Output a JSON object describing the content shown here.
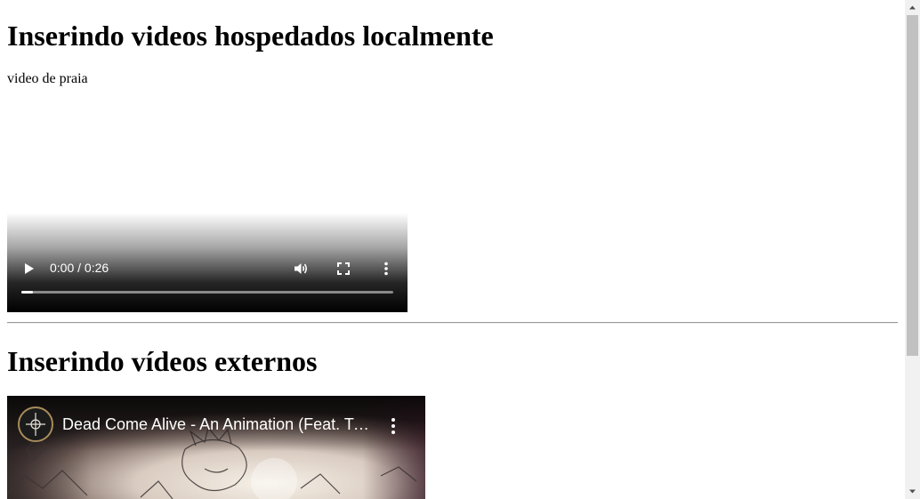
{
  "sections": {
    "local": {
      "heading": "Inserindo videos hospedados localmente",
      "caption": "video de praia",
      "player": {
        "time": "0:00 / 0:26",
        "progress_fraction": 0.03,
        "icons": [
          "play-icon",
          "volume-icon",
          "fullscreen-icon",
          "more-options-icon"
        ]
      }
    },
    "external": {
      "heading": "Inserindo vídeos externos",
      "embed": {
        "title": "Dead Come Alive - An Animation (Feat. Tyl…",
        "icons": [
          "channel-avatar-icon",
          "more-options-icon"
        ]
      }
    }
  },
  "colors": {
    "background": "#ffffff",
    "controls_gradient_end": "#000000",
    "divider": "#9a9a9a",
    "scrollbar_track": "#f1f1f1",
    "scrollbar_thumb": "#c1c1c1"
  }
}
